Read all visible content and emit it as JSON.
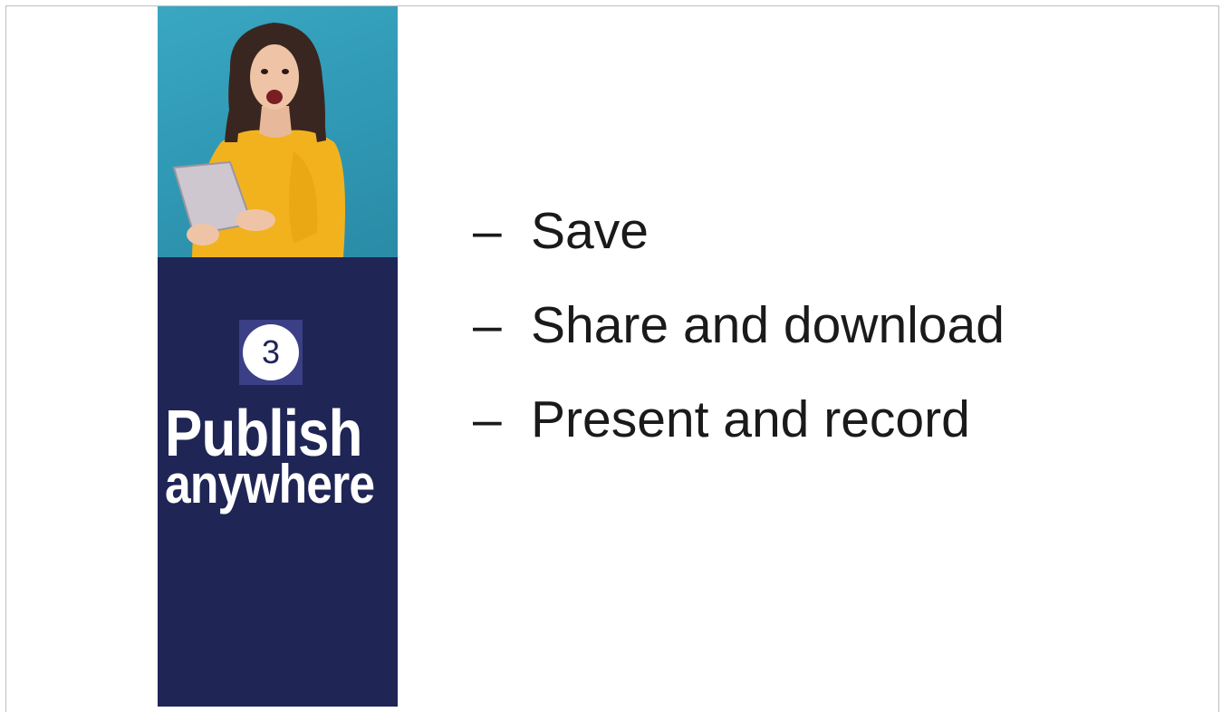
{
  "side_panel": {
    "step_number": "3",
    "heading_line1": "Publish",
    "heading_line2": "anywhere",
    "photo_description_icon": "woman-with-tablet-photo"
  },
  "bullets": [
    {
      "marker": "–",
      "text": "Save"
    },
    {
      "marker": "–",
      "text": "Share and download"
    },
    {
      "marker": "–",
      "text": "Present and record"
    }
  ],
  "colors": {
    "panel": "#1f2555",
    "badge": "#3b3f86",
    "photo_bg": "#3aa7c2",
    "sweater": "#f2b21e",
    "text": "#1a1a1a"
  }
}
